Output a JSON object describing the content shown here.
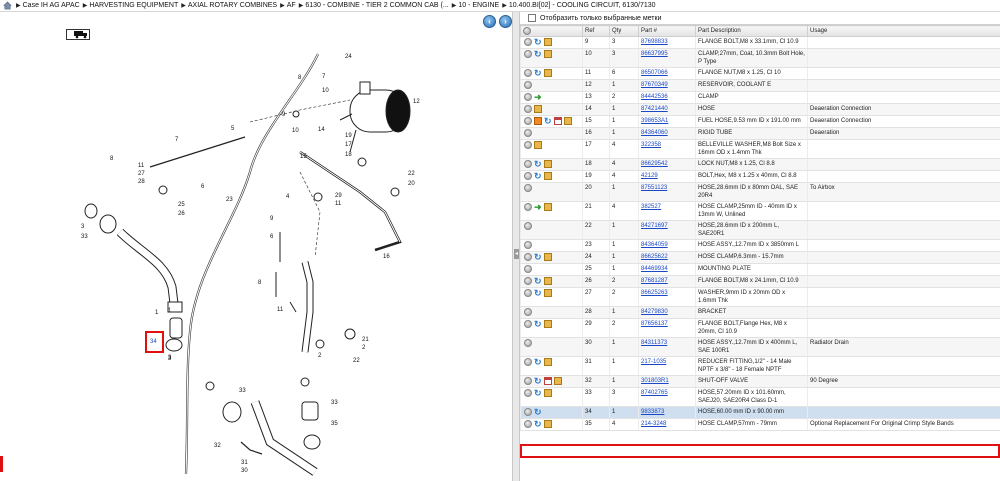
{
  "breadcrumb": [
    "Case IH AG APAC",
    "HARVESTING EQUIPMENT",
    "AXIAL ROTARY COMBINES",
    "AF",
    "6130 - COMBINE - TIER 2 COMMON CAB (...",
    "10 - ENGINE",
    "10.400.BI[02] - COOLING CIRCUIT, 6130/7130"
  ],
  "filter_label": "Отобразить только выбранные метки",
  "columns": [
    "Ref",
    "Qty",
    "Part #",
    "Part Description",
    "Usage"
  ],
  "rows": [
    {
      "icons": [
        "circle",
        "arrow",
        "box"
      ],
      "ref": "9",
      "qty": "3",
      "part": "87698833",
      "desc": "FLANGE BOLT,M8 x 33.1mm, Cl 10.9",
      "usage": "",
      "h": 1
    },
    {
      "icons": [
        "circle",
        "arrow",
        "box"
      ],
      "ref": "10",
      "qty": "3",
      "part": "86637995",
      "desc": "CLAMP,27mm, Coat, 10.3mm Bolt Hole, P Type",
      "usage": "",
      "h": 2
    },
    {
      "icons": [
        "circle",
        "arrow",
        "box"
      ],
      "ref": "11",
      "qty": "6",
      "part": "86507066",
      "desc": "FLANGE NUT,M8 x 1.25, Cl 10",
      "usage": "",
      "h": 1
    },
    {
      "icons": [
        "circle"
      ],
      "ref": "12",
      "qty": "1",
      "part": "87670349",
      "desc": "RESERVOIR, COOLANT E",
      "usage": "",
      "h": 1
    },
    {
      "icons": [
        "circle",
        "green"
      ],
      "ref": "13",
      "qty": "2",
      "part": "84442536",
      "desc": "CLAMP",
      "usage": "",
      "h": 1
    },
    {
      "icons": [
        "circle",
        "box"
      ],
      "ref": "14",
      "qty": "1",
      "part": "87421440",
      "desc": "HOSE",
      "usage": "Deaeration Connection",
      "h": 1
    },
    {
      "icons": [
        "circle",
        "orange",
        "arrow",
        "note",
        "box"
      ],
      "ref": "15",
      "qty": "1",
      "part": "398653A1",
      "desc": "FUEL HOSE,9.53 mm ID x 191.00 mm",
      "usage": "Deaeration Connection",
      "h": 1
    },
    {
      "icons": [
        "circle"
      ],
      "ref": "16",
      "qty": "1",
      "part": "84364060",
      "desc": "RIGID TUBE",
      "usage": "Deaeration",
      "h": 1
    },
    {
      "icons": [
        "circle",
        "box"
      ],
      "ref": "17",
      "qty": "4",
      "part": "322358",
      "desc": "BELLEVILLE WASHER,M8 Bolt Size x 16mm OD x 1.4mm Thk",
      "usage": "",
      "h": 2
    },
    {
      "icons": [
        "circle",
        "arrow",
        "box"
      ],
      "ref": "18",
      "qty": "4",
      "part": "86629542",
      "desc": "LOCK NUT,M8 x 1.25, Cl 8.8",
      "usage": "",
      "h": 1
    },
    {
      "icons": [
        "circle",
        "arrow",
        "box"
      ],
      "ref": "19",
      "qty": "4",
      "part": "42129",
      "desc": "BOLT,Hex, M8 x 1.25 x 40mm, Cl 8.8",
      "usage": "",
      "h": 1
    },
    {
      "icons": [
        "circle"
      ],
      "ref": "20",
      "qty": "1",
      "part": "87551123",
      "desc": "HOSE,28.6mm ID x 80mm OAL, SAE 20R4",
      "usage": "To Airbox",
      "h": 2
    },
    {
      "icons": [
        "circle",
        "green",
        "box"
      ],
      "ref": "21",
      "qty": "4",
      "part": "382527",
      "desc": "HOSE CLAMP,25mm ID - 40mm ID x 13mm W, Unlined",
      "usage": "",
      "h": 2
    },
    {
      "icons": [
        "circle"
      ],
      "ref": "22",
      "qty": "1",
      "part": "84271697",
      "desc": "HOSE,28.6mm ID x 200mm L, SAE20R1",
      "usage": "",
      "h": 1
    },
    {
      "icons": [
        "circle"
      ],
      "ref": "23",
      "qty": "1",
      "part": "84364059",
      "desc": "HOSE ASSY.,12.7mm ID x 3850mm L",
      "usage": "",
      "h": 1
    },
    {
      "icons": [
        "circle",
        "arrow",
        "box"
      ],
      "ref": "24",
      "qty": "1",
      "part": "86625622",
      "desc": "HOSE CLAMP,6.3mm - 15.7mm",
      "usage": "",
      "h": 1
    },
    {
      "icons": [
        "circle"
      ],
      "ref": "25",
      "qty": "1",
      "part": "84469934",
      "desc": "MOUNTING PLATE",
      "usage": "",
      "h": 1
    },
    {
      "icons": [
        "circle",
        "arrow",
        "box"
      ],
      "ref": "26",
      "qty": "2",
      "part": "87681287",
      "desc": "FLANGE BOLT,M8 x 24.1mm, Cl 10.9",
      "usage": "",
      "h": 1
    },
    {
      "icons": [
        "circle",
        "arrow",
        "box"
      ],
      "ref": "27",
      "qty": "2",
      "part": "86625263",
      "desc": "WASHER,9mm ID x 20mm OD x 1.6mm Thk",
      "usage": "",
      "h": 2
    },
    {
      "icons": [
        "circle"
      ],
      "ref": "28",
      "qty": "1",
      "part": "84279830",
      "desc": "BRACKET",
      "usage": "",
      "h": 1
    },
    {
      "icons": [
        "circle",
        "arrow",
        "box"
      ],
      "ref": "29",
      "qty": "2",
      "part": "87656137",
      "desc": "FLANGE BOLT,Flange Hex, M8 x 20mm, Cl 10.9",
      "usage": "",
      "h": 2
    },
    {
      "icons": [
        "circle"
      ],
      "ref": "30",
      "qty": "1",
      "part": "84311373",
      "desc": "HOSE ASSY.,12.7mm ID x 400mm L, SAE 100R1",
      "usage": "Radiator Drain",
      "h": 2
    },
    {
      "icons": [
        "circle",
        "arrow",
        "box"
      ],
      "ref": "31",
      "qty": "1",
      "part": "217-1035",
      "desc": "REDUCER FITTING,1/2\" - 14 Male NPTF x 3/8\" - 18 Female NPTF",
      "usage": "",
      "h": 2
    },
    {
      "icons": [
        "circle",
        "arrow",
        "note",
        "box"
      ],
      "ref": "32",
      "qty": "1",
      "part": "301803R1",
      "desc": "SHUT-OFF VALVE",
      "usage": "90 Degree",
      "h": 1
    },
    {
      "icons": [
        "circle",
        "arrow",
        "box"
      ],
      "ref": "33",
      "qty": "3",
      "part": "87402765",
      "desc": "HOSE,57.20mm ID x 101.60mm, SAEJ20, SAE20R4 Class D-1",
      "usage": "",
      "h": 2
    },
    {
      "icons": [
        "circle",
        "arrow"
      ],
      "ref": "34",
      "qty": "1",
      "part": "9833873",
      "desc": "HOSE,60.00 mm ID x 90.00 mm",
      "usage": "",
      "h": 1,
      "selected": true
    },
    {
      "icons": [
        "circle",
        "arrow",
        "box"
      ],
      "ref": "35",
      "qty": "4",
      "part": "214-3248",
      "desc": "HOSE CLAMP,57mm - 79mm",
      "usage": "Optional Replacement For Original Crimp Style Bands",
      "h": 1
    }
  ],
  "diagram_callouts": [
    "24",
    "8",
    "7",
    "10",
    "12",
    "13",
    "9",
    "5",
    "10",
    "14",
    "7",
    "8",
    "11",
    "27",
    "28",
    "25",
    "26",
    "6",
    "19",
    "17",
    "18",
    "22",
    "20",
    "15",
    "29",
    "11",
    "23",
    "3",
    "33",
    "4",
    "9",
    "6",
    "16",
    "3",
    "1",
    "8",
    "11",
    "1",
    "34",
    "3",
    "21",
    "2",
    "22",
    "2",
    "33",
    "33",
    "35",
    "32",
    "31",
    "30"
  ],
  "colors": {
    "accent": "#2b6fb6",
    "selected_outline": "#e01010",
    "link": "#1a49c8"
  }
}
